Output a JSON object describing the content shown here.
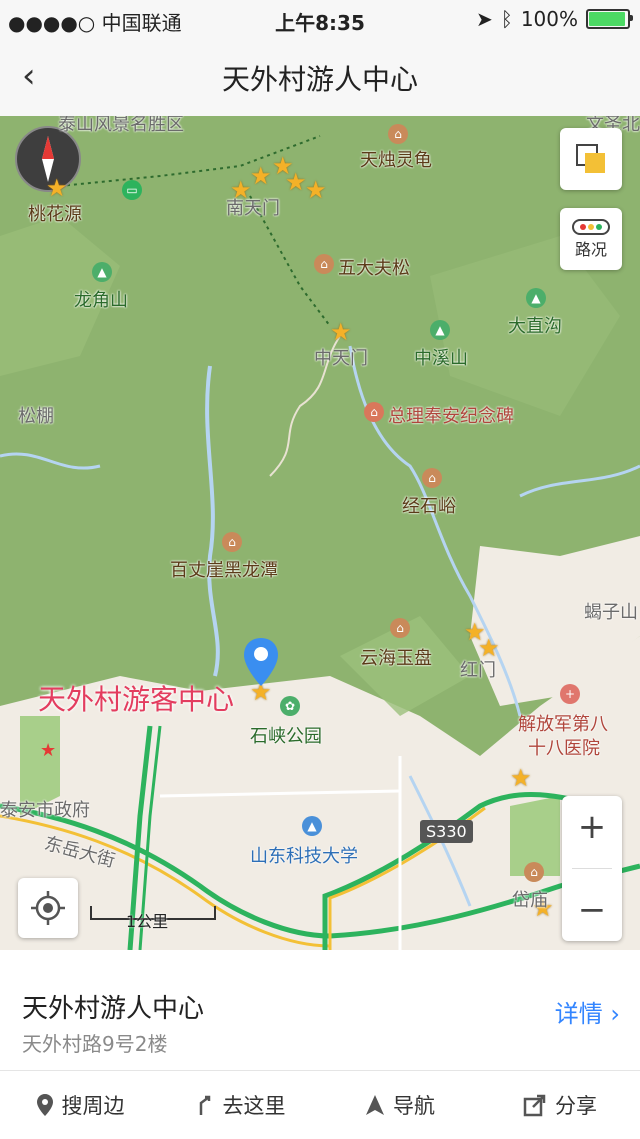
{
  "status_bar": {
    "carrier": "●●●●○ 中国联通",
    "time": "上午8:35",
    "battery": "100%"
  },
  "navbar": {
    "title": "天外村游人中心"
  },
  "map": {
    "labels": {
      "taohuayuan": "桃花源",
      "nantianmen": "南天门",
      "tianzhu": "天烛灵龟",
      "wudafu": "五大夫松",
      "longjiao": "龙角山",
      "dazhigou": "大直沟",
      "zhongtianmen": "中天门",
      "zhongxi": "中溪山",
      "songpeng": "松棚",
      "zongli": "总理奉安纪念碑",
      "jingshiyu": "经石峪",
      "baizhang": "百丈崖黑龙潭",
      "yunhai": "云海玉盘",
      "hongmen": "红门",
      "xiezi": "蝎子山",
      "shixia": "石峡公园",
      "hospital_1": "解放军第八",
      "hospital_2": "十八医院",
      "taian_gov": "泰安市政府",
      "dongyue": "东岳大街",
      "shandong_univ": "山东科技大学",
      "s330": "S330",
      "daimiao": "岱庙",
      "top_scenic": "泰山风景名胜区",
      "top_right": "文圣北"
    },
    "highlight_label": "天外村游客中心",
    "traffic_label": "路况",
    "scale_label": "1公里",
    "zoom_in": "+",
    "zoom_out": "−"
  },
  "place": {
    "name": "天外村游人中心",
    "address": "天外村路9号2楼",
    "detail_label": "详情 ›"
  },
  "actions": [
    {
      "label": "搜周边",
      "icon": "location-pin-icon"
    },
    {
      "label": "去这里",
      "icon": "route-icon"
    },
    {
      "label": "导航",
      "icon": "navigate-arrow-icon"
    },
    {
      "label": "分享",
      "icon": "share-icon"
    }
  ]
}
